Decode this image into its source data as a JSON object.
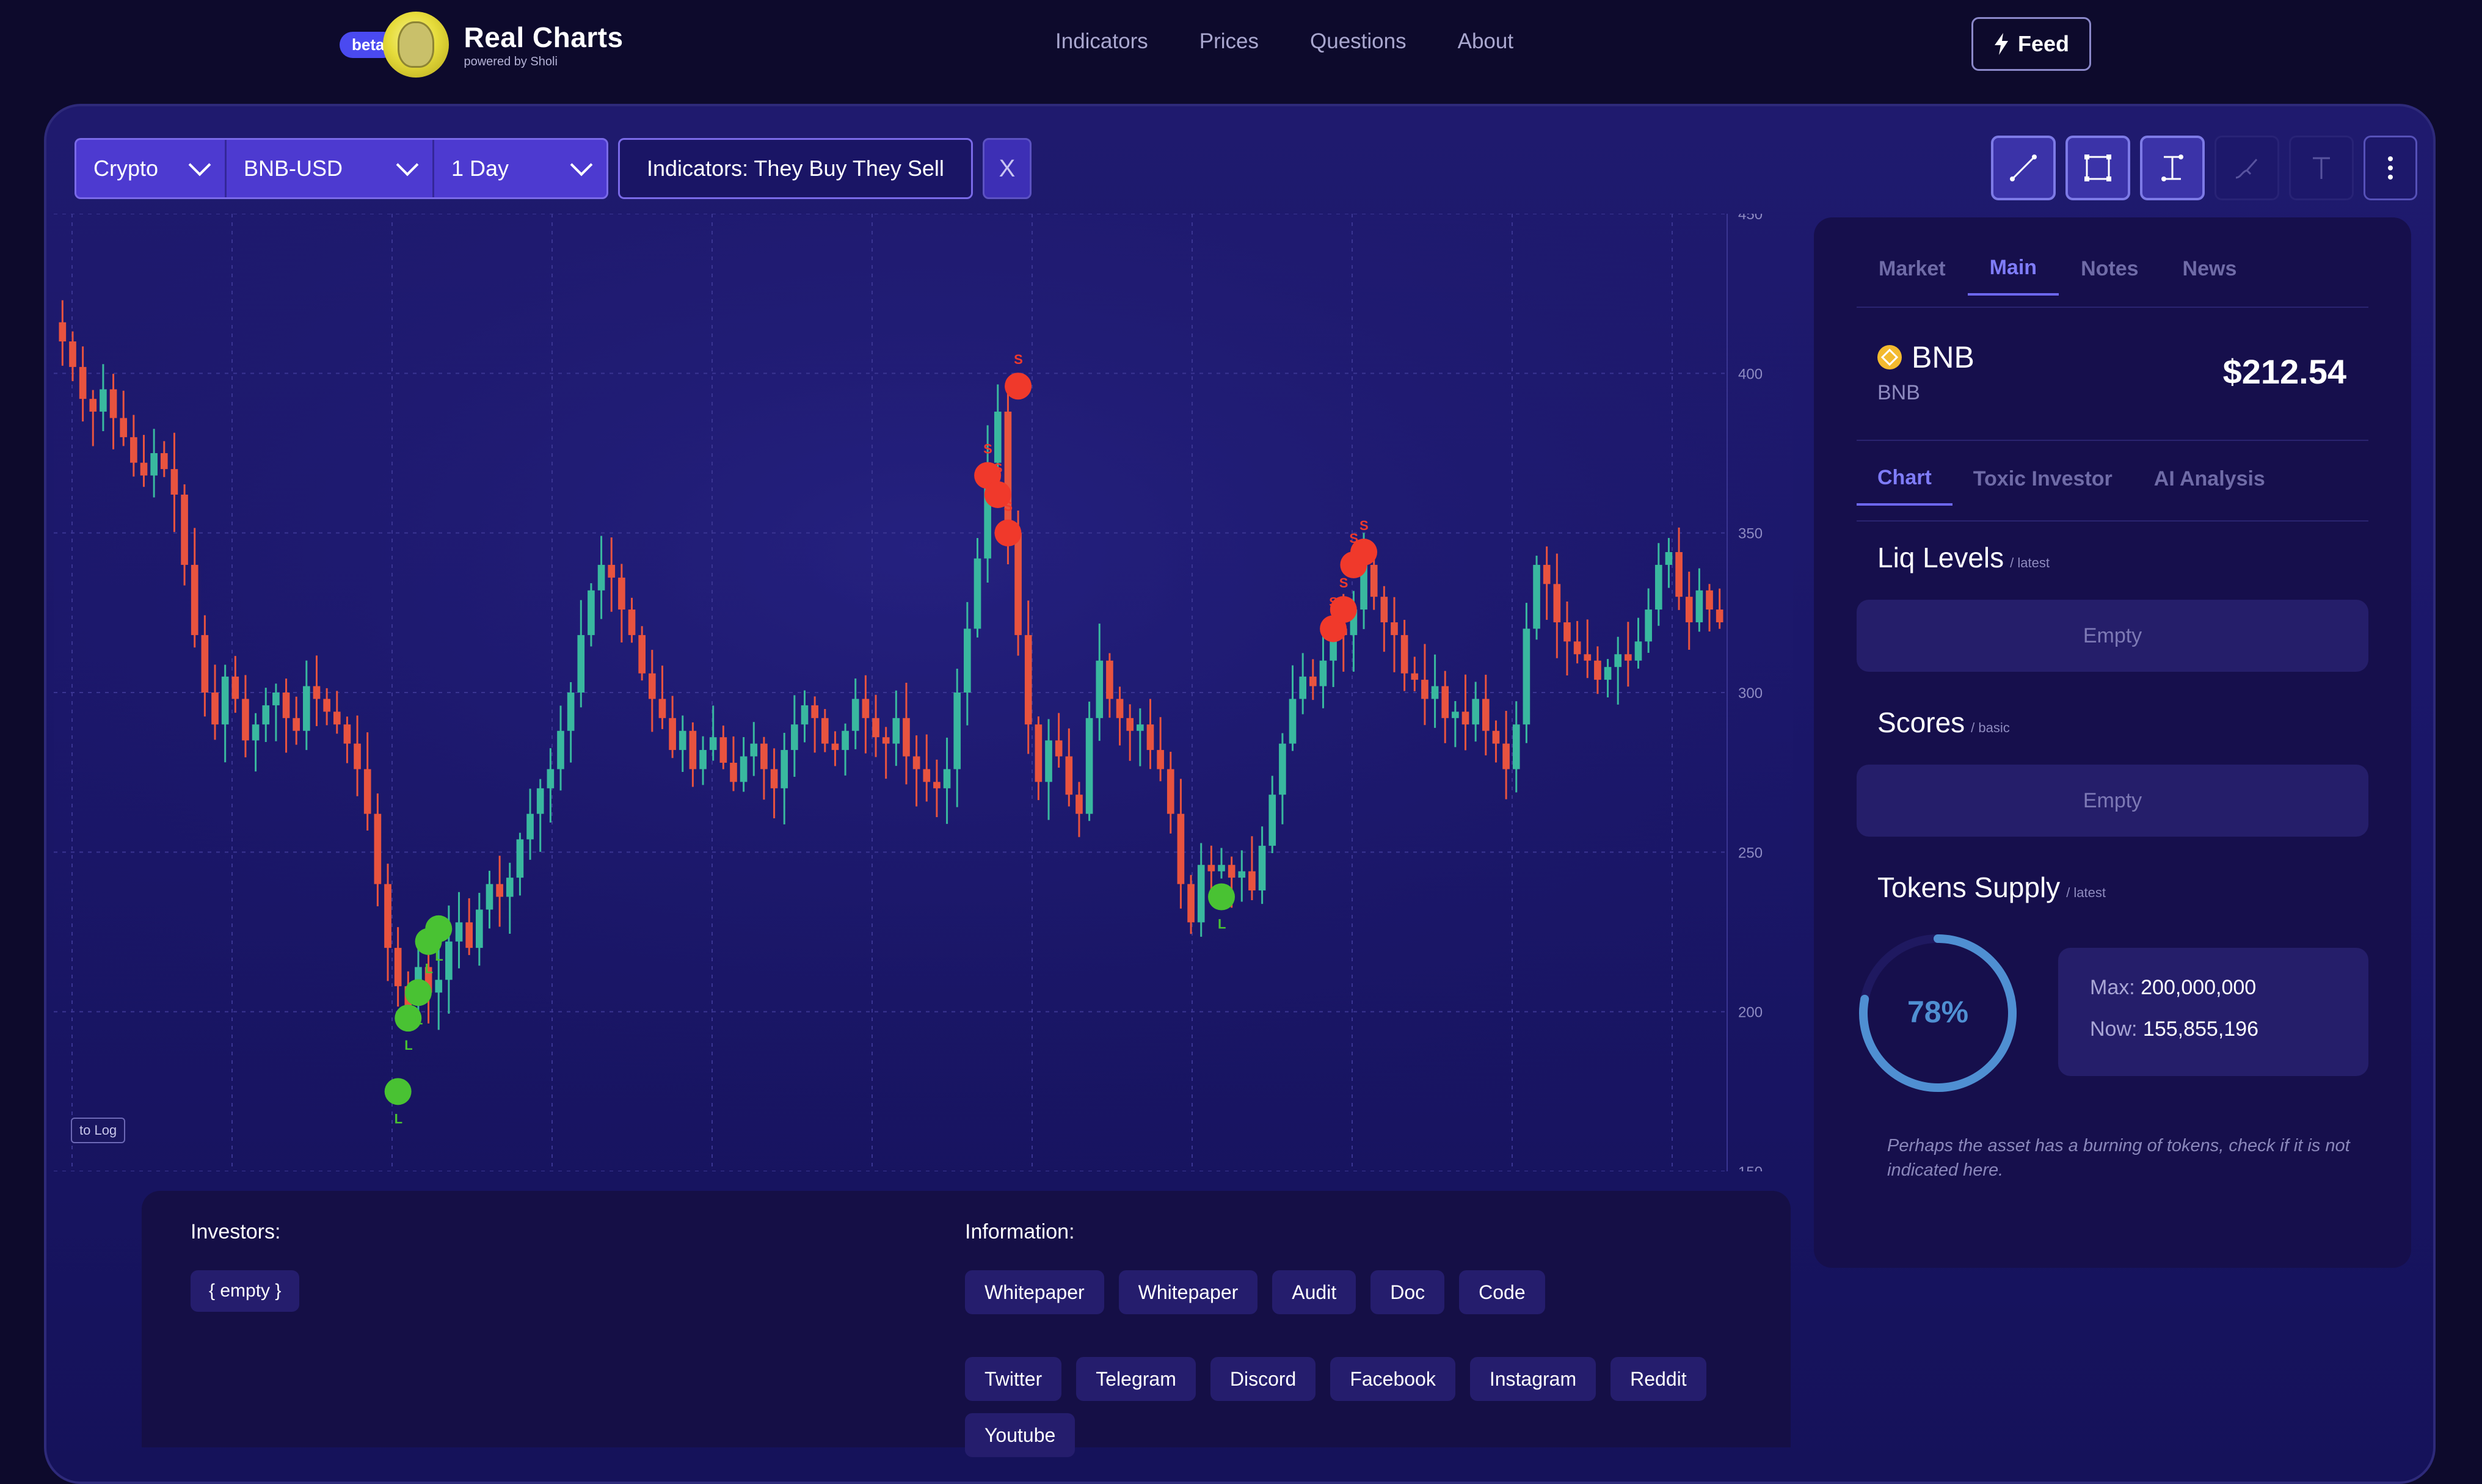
{
  "header": {
    "beta_label": "beta",
    "brand_title": "Real Charts",
    "brand_sub": "powered by Sholi",
    "nav": [
      "Indicators",
      "Prices",
      "Questions",
      "About"
    ],
    "feed_label": "Feed"
  },
  "toolbar": {
    "market": "Crypto",
    "pair": "BNB-USD",
    "interval": "1 Day",
    "indicators": "Indicators: They Buy They Sell",
    "close_label": "X"
  },
  "chart": {
    "log_button": "to Log",
    "y_ticks": [
      "450",
      "400",
      "350",
      "300",
      "250",
      "200",
      "150"
    ],
    "buy_marker": "L",
    "sell_marker": "S",
    "colors": {
      "up": "#39b89f",
      "down": "#e8533f",
      "buy": "#49c233",
      "sell": "#f0392b"
    }
  },
  "chart_data": {
    "type": "candlestick",
    "title": "",
    "xlabel": "",
    "ylabel": "",
    "ylim": [
      150,
      450
    ],
    "close": [
      410,
      402,
      392,
      388,
      395,
      386,
      380,
      372,
      368,
      375,
      370,
      362,
      340,
      318,
      300,
      290,
      305,
      298,
      285,
      290,
      296,
      300,
      292,
      288,
      302,
      298,
      294,
      290,
      284,
      276,
      262,
      240,
      220,
      208,
      202,
      214,
      206,
      210,
      222,
      228,
      220,
      232,
      240,
      236,
      242,
      254,
      262,
      270,
      276,
      288,
      300,
      318,
      332,
      340,
      336,
      326,
      318,
      306,
      298,
      292,
      282,
      288,
      276,
      282,
      286,
      278,
      272,
      280,
      284,
      276,
      270,
      282,
      290,
      296,
      292,
      284,
      282,
      288,
      298,
      292,
      286,
      284,
      292,
      280,
      276,
      272,
      270,
      276,
      300,
      320,
      342,
      372,
      388,
      350,
      318,
      290,
      272,
      285,
      280,
      268,
      262,
      292,
      310,
      298,
      292,
      288,
      290,
      282,
      276,
      262,
      240,
      228,
      246,
      244,
      246,
      242,
      244,
      238,
      252,
      268,
      284,
      298,
      305,
      302,
      310,
      320,
      318,
      326,
      340,
      330,
      322,
      318,
      306,
      304,
      298,
      302,
      292,
      294,
      290,
      298,
      288,
      284,
      276,
      290,
      320,
      340,
      334,
      322,
      316,
      312,
      310,
      304,
      308,
      312,
      310,
      316,
      326,
      340,
      344,
      330,
      322,
      332,
      326,
      322
    ],
    "buy_signals": [
      {
        "index": 33,
        "value": 175
      },
      {
        "index": 34,
        "value": 198
      },
      {
        "index": 35,
        "value": 206
      },
      {
        "index": 36,
        "value": 222
      },
      {
        "index": 37,
        "value": 226
      },
      {
        "index": 114,
        "value": 236
      }
    ],
    "sell_signals": [
      {
        "index": 91,
        "value": 368
      },
      {
        "index": 92,
        "value": 362
      },
      {
        "index": 93,
        "value": 350
      },
      {
        "index": 94,
        "value": 396
      },
      {
        "index": 125,
        "value": 320
      },
      {
        "index": 126,
        "value": 326
      },
      {
        "index": 127,
        "value": 340
      },
      {
        "index": 128,
        "value": 344
      }
    ]
  },
  "info": {
    "investors_label": "Investors:",
    "investors_value": "{ empty }",
    "information_label": "Information:",
    "docs": [
      "Whitepaper",
      "Whitepaper",
      "Audit",
      "Doc",
      "Code"
    ],
    "socials": [
      "Twitter",
      "Telegram",
      "Discord",
      "Facebook",
      "Instagram",
      "Reddit"
    ],
    "more": [
      "Youtube"
    ]
  },
  "side": {
    "tabs": [
      "Market",
      "Main",
      "Notes",
      "News"
    ],
    "active_tab": "Main",
    "coin_name": "BNB",
    "coin_symbol": "BNB",
    "price": "$212.54",
    "subtabs": [
      "Chart",
      "Toxic Investor",
      "AI Analysis"
    ],
    "liq_title": "Liq Levels",
    "liq_sub": "/ latest",
    "liq_value": "Empty",
    "scores_title": "Scores",
    "scores_sub": "/ basic",
    "scores_value": "Empty",
    "supply_title": "Tokens Supply",
    "supply_sub": "/ latest",
    "supply_percent": "78%",
    "supply_fraction": 0.78,
    "max_label": "Max:",
    "max_value": "200,000,000",
    "now_label": "Now:",
    "now_value": "155,855,196",
    "note": "Perhaps the asset has a burning of tokens, check if it is not indicated here."
  }
}
